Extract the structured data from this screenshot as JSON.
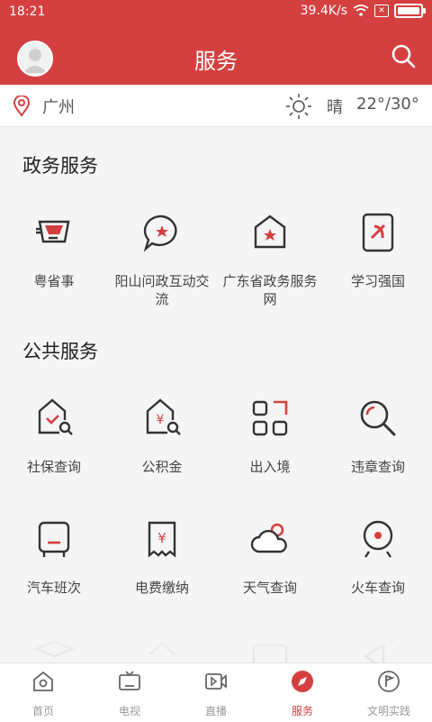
{
  "status": {
    "time": "18:21",
    "speed": "39.4K/s",
    "battery_percent": 85
  },
  "header": {
    "title": "服务"
  },
  "location": {
    "city": "广州",
    "weather": "晴",
    "temp": "22°/30°"
  },
  "sections": [
    {
      "title": "政务服务",
      "items": [
        {
          "label": "粤省事",
          "icon": "yueshengshi-icon"
        },
        {
          "label": "阳山问政互动交流",
          "icon": "chat-bubble-star-icon"
        },
        {
          "label": "广东省政务服务网",
          "icon": "building-star-icon"
        },
        {
          "label": "学习强国",
          "icon": "xuexi-icon"
        }
      ]
    },
    {
      "title": "公共服务",
      "items": [
        {
          "label": "社保查询",
          "icon": "house-check-search-icon"
        },
        {
          "label": "公积金",
          "icon": "house-yen-search-icon"
        },
        {
          "label": "出入境",
          "icon": "passport-frames-icon"
        },
        {
          "label": "违章查询",
          "icon": "magnifier-icon"
        },
        {
          "label": "汽车班次",
          "icon": "bus-icon"
        },
        {
          "label": "电费缴纳",
          "icon": "bill-yen-icon"
        },
        {
          "label": "天气查询",
          "icon": "cloud-sun-icon"
        },
        {
          "label": "火车查询",
          "icon": "train-icon"
        }
      ]
    }
  ],
  "tabs": [
    {
      "label": "首页",
      "icon": "home-icon"
    },
    {
      "label": "电视",
      "icon": "tv-icon"
    },
    {
      "label": "直播",
      "icon": "video-icon"
    },
    {
      "label": "服务",
      "icon": "compass-icon",
      "active": true
    },
    {
      "label": "文明实践",
      "icon": "flag-icon"
    }
  ],
  "colors": {
    "brand": "#d44040",
    "icon_stroke": "#333333"
  }
}
